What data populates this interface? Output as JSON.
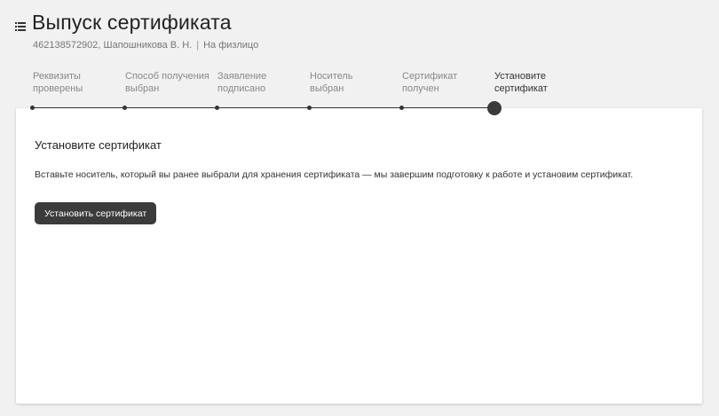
{
  "header": {
    "title": "Выпуск сертификата",
    "subtitle_left": "462138572902, Шапошникова В. Н.",
    "subtitle_sep": "|",
    "subtitle_right": "На физлицо"
  },
  "steps": [
    {
      "line1": "Реквизиты",
      "line2": "проверены"
    },
    {
      "line1": "Способ получения",
      "line2": "выбран"
    },
    {
      "line1": "Заявление",
      "line2": "подписано"
    },
    {
      "line1": "Носитель",
      "line2": "выбран"
    },
    {
      "line1": "Сертификат",
      "line2": "получен"
    },
    {
      "line1": "Установите",
      "line2": "сертификат"
    }
  ],
  "card": {
    "title": "Установите сертификат",
    "text": "Вставьте носитель, который вы ранее выбрали для хранения сертификата — мы завершим подготовку к работе и установим сертификат.",
    "button_label": "Установить сертификат"
  }
}
